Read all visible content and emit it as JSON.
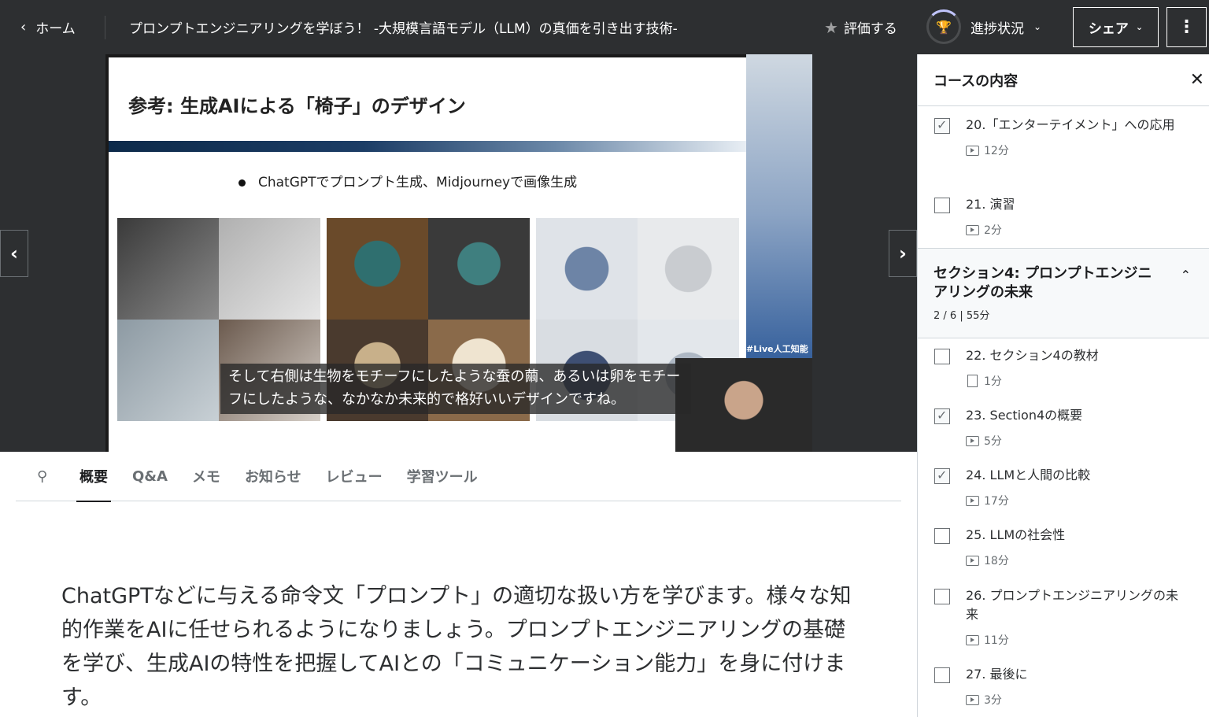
{
  "header": {
    "home_label": "ホーム",
    "course_title": "プロンプトエンジニアリングを学ぼう！ -大規模言語モデル（LLM）の真価を引き出す技術-",
    "rate_label": "評価する",
    "progress_label": "進捗状況",
    "share_label": "シェア"
  },
  "video": {
    "slide_title": "参考: 生成AIによる「椅子」のデザイン",
    "slide_bullet": "ChatGPTでプロンプト生成、Midjourneyで画像生成",
    "side_tag": "#Live人工知能",
    "caption": "そして右側は生物をモチーフにしたような蚕の繭、あるいは卵をモチーフにしたような、なかなか未来的で格好いいデザインですね。"
  },
  "tabs": [
    {
      "label": "概要",
      "active": true
    },
    {
      "label": "Q&A",
      "active": false
    },
    {
      "label": "メモ",
      "active": false
    },
    {
      "label": "お知らせ",
      "active": false
    },
    {
      "label": "レビュー",
      "active": false
    },
    {
      "label": "学習ツール",
      "active": false
    }
  ],
  "overview_text": "ChatGPTなどに与える命令文「プロンプト」の適切な扱い方を学びます。様々な知的作業をAIに任せられるようになりましょう。プロンプトエンジニアリングの基礎を学び、生成AIの特性を把握してAIとの「コミュニケーション能力」を身に付けます。",
  "sidebar": {
    "title": "コースの内容",
    "lectures_before": [
      {
        "title": "20.「エンターテイメント」への応用",
        "duration": "12分",
        "checked": true,
        "type": "video"
      },
      {
        "title": "21. 演習",
        "duration": "2分",
        "checked": false,
        "type": "video"
      }
    ],
    "section": {
      "title": "セクション4: プロンプトエンジニアリングの未来",
      "meta": "2 / 6 | 55分"
    },
    "lectures_after": [
      {
        "title": "22. セクション4の教材",
        "duration": "1分",
        "checked": false,
        "type": "doc"
      },
      {
        "title": "23. Section4の概要",
        "duration": "5分",
        "checked": true,
        "type": "video"
      },
      {
        "title": "24. LLMと人間の比較",
        "duration": "17分",
        "checked": true,
        "type": "video"
      },
      {
        "title": "25. LLMの社会性",
        "duration": "18分",
        "checked": false,
        "type": "video"
      },
      {
        "title": "26. プロンプトエンジニアリングの未来",
        "duration": "11分",
        "checked": false,
        "type": "video"
      },
      {
        "title": "27. 最後に",
        "duration": "3分",
        "checked": false,
        "type": "video"
      }
    ]
  }
}
